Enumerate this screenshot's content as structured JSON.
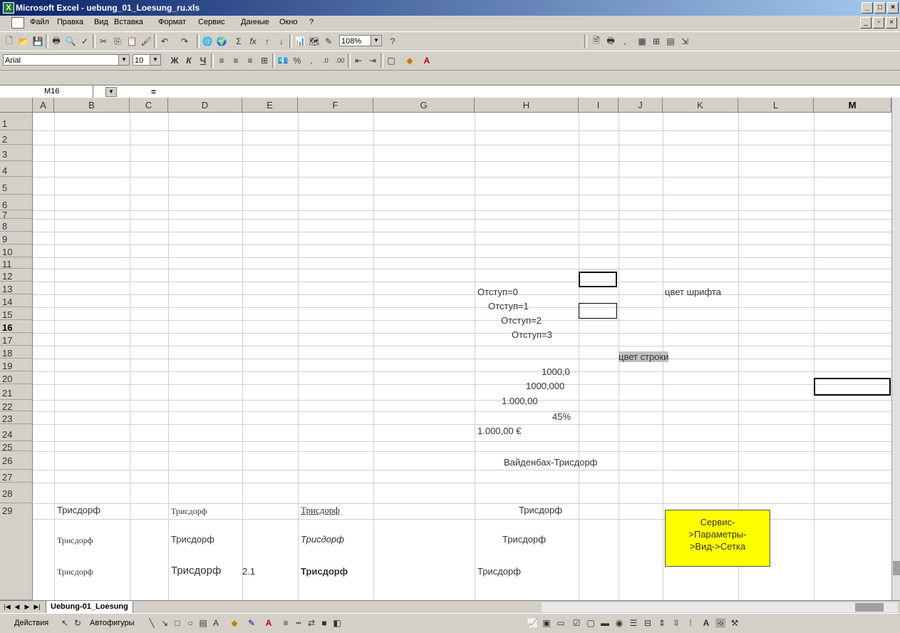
{
  "window": {
    "title": "Microsoft Excel - uebung_01_Loesung_ru.xls",
    "app_icon": "excel-icon",
    "controls": [
      "minimize",
      "maximize",
      "close"
    ]
  },
  "menu": {
    "items": [
      "Файл",
      "Правка",
      "Вид",
      "Вставка",
      "Формат",
      "Сервис",
      "Данные",
      "Окно",
      "?"
    ]
  },
  "toolbar": {
    "zoom": "108%",
    "font_name": "Arial",
    "font_size": "10",
    "bold": "Ж",
    "italic": "К",
    "underline": "Ч",
    "percent": "%",
    "comma": ",",
    "autosum": "Σ",
    "function": "fx",
    "help": "?"
  },
  "formula_bar": {
    "name_box": "M16",
    "equals": "="
  },
  "sheet": {
    "columns": [
      "A",
      "B",
      "C",
      "D",
      "E",
      "F",
      "G",
      "H",
      "I",
      "J",
      "K",
      "L",
      "M"
    ],
    "selected_column": "M",
    "rows": [
      "1",
      "2",
      "3",
      "4",
      "5",
      "6",
      "7",
      "8",
      "9",
      "10",
      "11",
      "12",
      "13",
      "14",
      "15",
      "16",
      "17",
      "18",
      "19",
      "20",
      "21",
      "22",
      "23",
      "24",
      "25",
      "26",
      "27",
      "28",
      "29"
    ],
    "selected_row": "16",
    "cells": {
      "h10": "Отступ=0",
      "h11": "Отступ=1",
      "h12": "Отступ=2",
      "h13": "Отступ=3",
      "k10": "цвет шрифта",
      "j14": "цвет строки",
      "h15": "1000,0",
      "h16": "1000,000",
      "h17": "1.000,00",
      "h18": "45%",
      "h19": "1.000,00 €",
      "h21": "Вайденбах-Трисдорф",
      "b24": "Трисдорф",
      "d24": "Трисдорф",
      "f24": "Трисдорф",
      "h24": "Трисдорф",
      "b26": "Трисдорф",
      "d26": "Трисдорф",
      "f26": "Трисдорф",
      "h26": "Трисдорф",
      "b28": "Трисдорф",
      "d28": "Трисдорф",
      "e28": "2.1",
      "f28": "Трисдорф",
      "h28": "Трисдорф"
    },
    "textbox": {
      "line1": "Сервис-",
      "line2": ">Параметры-",
      "line3": ">Вид->Сетка",
      "fill": "#ffff00"
    },
    "tab": "Uebung-01_Loesung"
  },
  "drawing_toolbar": {
    "actions": "Действия",
    "autoshapes": "Автофигуры"
  }
}
